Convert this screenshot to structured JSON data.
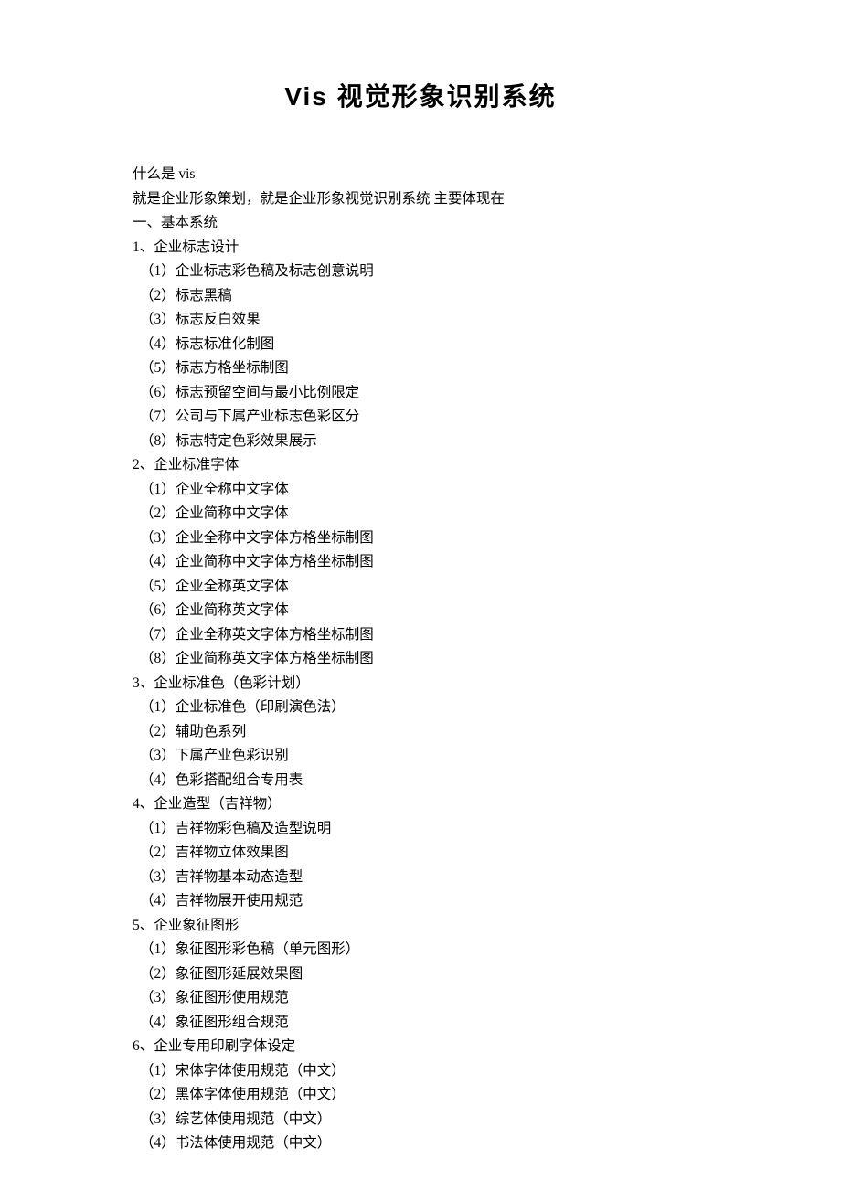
{
  "title": "Vis 视觉形象识别系统",
  "intro_q": "什么是 vis",
  "intro_a": "就是企业形象策划，就是企业形象视觉识别系统 主要体现在",
  "section_header": "一、基本系统",
  "s1": {
    "h": "1、企业标志设计",
    "i1": "（1）企业标志彩色稿及标志创意说明",
    "i2": "（2）标志黑稿",
    "i3": "（3）标志反白效果",
    "i4": "（4）标志标准化制图",
    "i5": "（5）标志方格坐标制图",
    "i6": "（6）标志预留空间与最小比例限定",
    "i7": "（7）公司与下属产业标志色彩区分",
    "i8": "（8）标志特定色彩效果展示"
  },
  "s2": {
    "h": "2、企业标准字体",
    "i1": "（1）企业全称中文字体",
    "i2": "（2）企业简称中文字体",
    "i3": "（3）企业全称中文字体方格坐标制图",
    "i4": "（4）企业简称中文字体方格坐标制图",
    "i5": "（5）企业全称英文字体",
    "i6": "（6）企业简称英文字体",
    "i7": "（7）企业全称英文字体方格坐标制图",
    "i8": "（8）企业简称英文字体方格坐标制图"
  },
  "s3": {
    "h": "3、企业标准色（色彩计划）",
    "i1": "（1）企业标准色（印刷演色法）",
    "i2": "（2）辅助色系列",
    "i3": "（3）下属产业色彩识别",
    "i4": "（4）色彩搭配组合专用表"
  },
  "s4": {
    "h": "4、企业造型（吉祥物）",
    "i1": "（1）吉祥物彩色稿及造型说明",
    "i2": "（2）吉祥物立体效果图",
    "i3": "（3）吉祥物基本动态造型",
    "i4": "（4）吉祥物展开使用规范"
  },
  "s5": {
    "h": "5、企业象征图形",
    "i1": "（1）象征图形彩色稿（单元图形）",
    "i2": "（2）象征图形延展效果图",
    "i3": "（3）象征图形使用规范",
    "i4": "（4）象征图形组合规范"
  },
  "s6": {
    "h": "6、企业专用印刷字体设定",
    "i1": "（1）宋体字体使用规范（中文）",
    "i2": "（2）黑体字体使用规范（中文）",
    "i3": "（3）综艺体使用规范（中文）",
    "i4": "（4）书法体使用规范（中文）"
  }
}
